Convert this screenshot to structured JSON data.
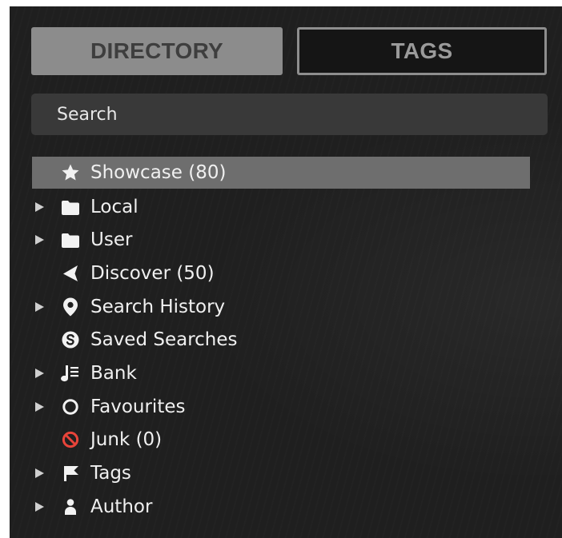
{
  "tabs": {
    "directory_label": "DIRECTORY",
    "tags_label": "TAGS"
  },
  "search": {
    "placeholder": "Search"
  },
  "tree": {
    "items": [
      {
        "label": "Showcase (80)",
        "icon": "star-icon",
        "expandable": false,
        "selected": true
      },
      {
        "label": "Local",
        "icon": "folder-icon",
        "expandable": true
      },
      {
        "label": "User",
        "icon": "folder-icon",
        "expandable": true
      },
      {
        "label": "Discover (50)",
        "icon": "discover-arrow-icon",
        "expandable": false
      },
      {
        "label": "Search History",
        "icon": "map-pin-icon",
        "expandable": true
      },
      {
        "label": "Saved Searches",
        "icon": "saved-search-icon",
        "expandable": false
      },
      {
        "label": "Bank",
        "icon": "bank-music-icon",
        "expandable": true
      },
      {
        "label": "Favourites",
        "icon": "circle-icon",
        "expandable": true
      },
      {
        "label": "Junk (0)",
        "icon": "junk-icon",
        "expandable": false
      },
      {
        "label": "Tags",
        "icon": "flag-icon",
        "expandable": true
      },
      {
        "label": "Author",
        "icon": "person-icon",
        "expandable": true
      }
    ]
  },
  "colors": {
    "panel_bg": "#1f1f1f",
    "tab_active_bg": "#8c8c8c",
    "selected_row_bg": "#6e6e6e",
    "junk_icon": "#e8443a"
  }
}
